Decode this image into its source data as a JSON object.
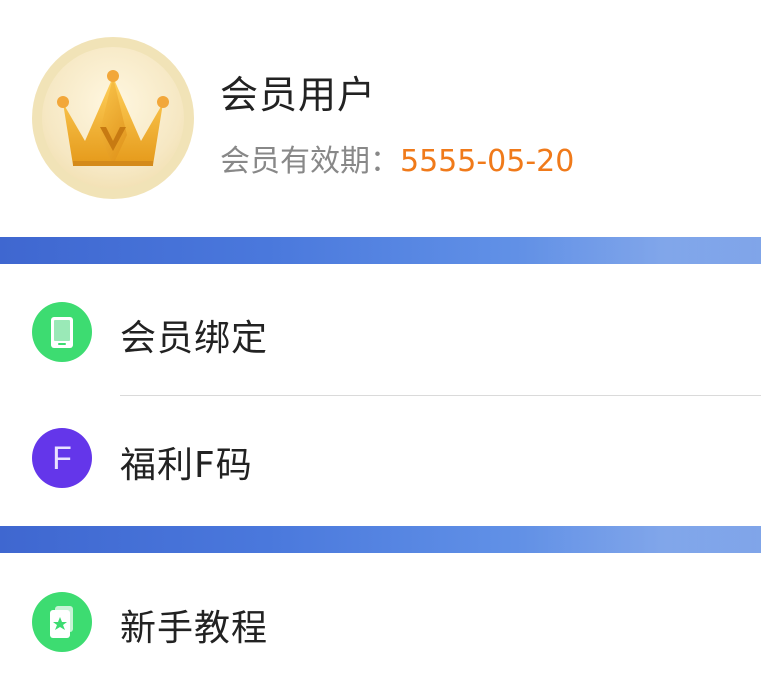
{
  "profile": {
    "username": "会员用户",
    "validity_label": "会员有效期：",
    "validity_date": "5555-05-20",
    "avatar_icon": "crown-icon"
  },
  "menu_group_1": [
    {
      "label": "会员绑定",
      "icon": "tablet-icon",
      "icon_color": "#3ddc71"
    },
    {
      "label": "福利F码",
      "icon": "letter-f-icon",
      "icon_text": "F",
      "icon_color": "#6436ea"
    }
  ],
  "menu_group_2": [
    {
      "label": "新手教程",
      "icon": "star-card-icon",
      "icon_color": "#3ddc71"
    }
  ],
  "colors": {
    "accent_orange": "#f07a1a",
    "band_blue": "#4a78dc"
  }
}
